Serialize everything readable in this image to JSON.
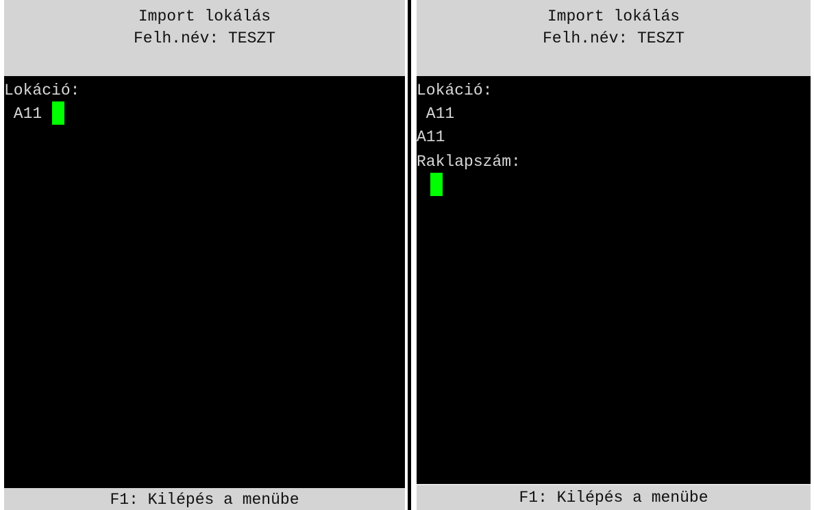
{
  "left_screen": {
    "header": {
      "title": "Import lokálás",
      "user_line": "Felh.név: TESZT"
    },
    "location_label": "Lokáció:",
    "location_input_value": " A11",
    "footer": "F1: Kilépés a menübe"
  },
  "right_screen": {
    "header": {
      "title": "Import lokálás",
      "user_line": "Felh.név: TESZT"
    },
    "location_label": "Lokáció:",
    "location_input_value": " A11",
    "location_confirmed": "A11",
    "pallet_label": "Raklapszám:",
    "pallet_input_value": "",
    "footer": "F1: Kilépés a menübe"
  },
  "colors": {
    "screen_background": "#000000",
    "bar_background": "#d4d4d4",
    "text": "#d8d8d8",
    "cursor": "#00ff00"
  }
}
